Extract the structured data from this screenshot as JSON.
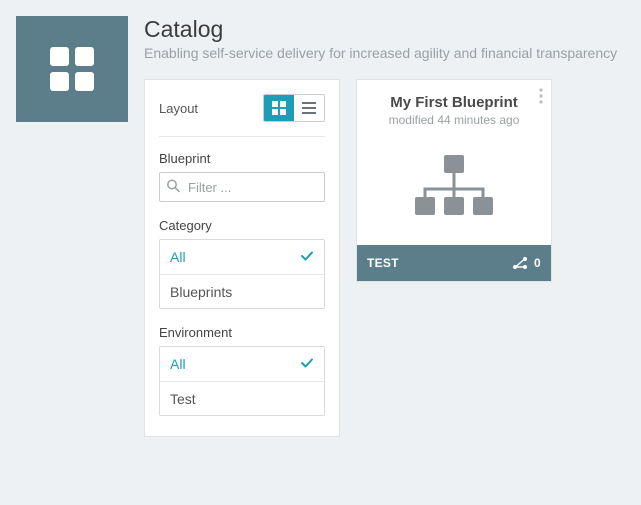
{
  "header": {
    "title": "Catalog",
    "subtitle": "Enabling self-service delivery for increased agility and financial transparency"
  },
  "sidebar": {
    "layout_label": "Layout",
    "blueprint": {
      "label": "Blueprint",
      "filter_placeholder": "Filter ..."
    },
    "category": {
      "label": "Category",
      "options": [
        "All",
        "Blueprints"
      ],
      "selected_index": 0
    },
    "environment": {
      "label": "Environment",
      "options": [
        "All",
        "Test"
      ],
      "selected_index": 0
    }
  },
  "card": {
    "title": "My First Blueprint",
    "subtitle": "modified 44 minutes ago",
    "footer_label": "TEST",
    "footer_count": "0"
  }
}
